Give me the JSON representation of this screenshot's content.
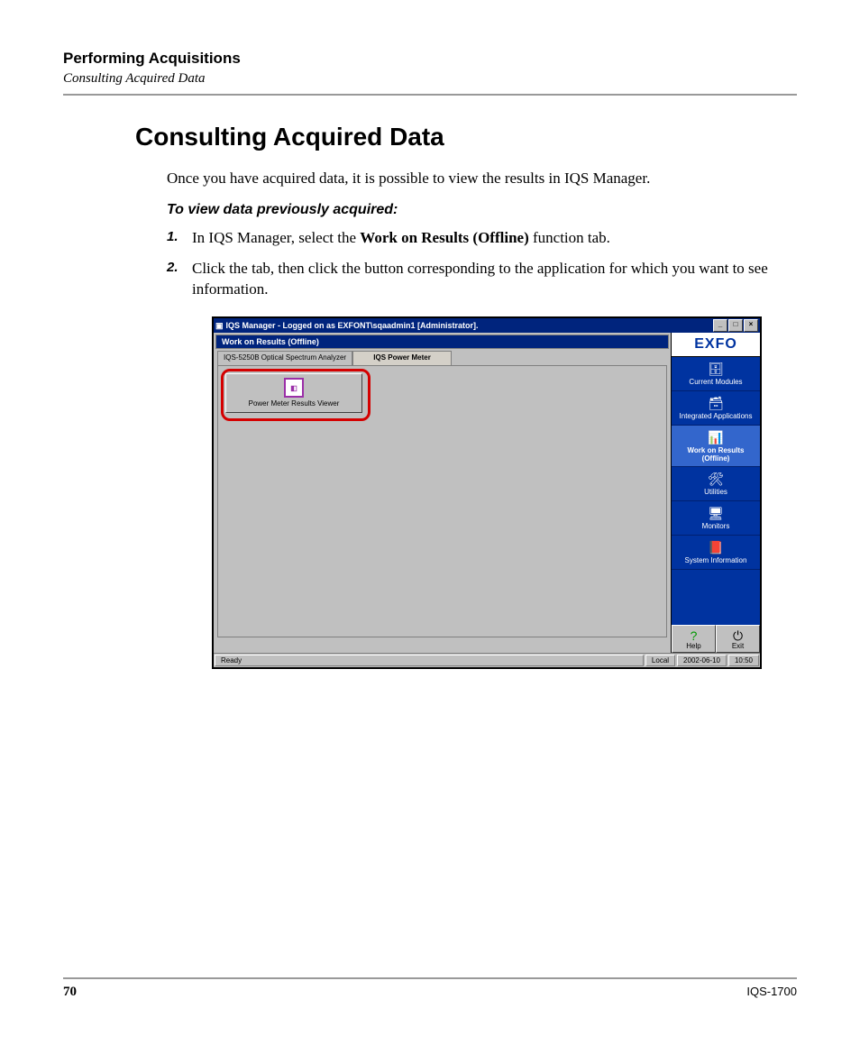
{
  "header": {
    "chapter": "Performing Acquisitions",
    "section_sub": "Consulting Acquired Data"
  },
  "section": {
    "title": "Consulting Acquired Data",
    "intro": "Once you have acquired data, it is possible to view the results in IQS Manager.",
    "procedure_title": "To view data previously acquired:",
    "steps": [
      {
        "num": "1.",
        "pre": "In IQS Manager, select the ",
        "bold": "Work on Results (Offline)",
        "post": " function tab."
      },
      {
        "num": "2.",
        "pre": "Click the tab, then click the button corresponding to the application for which you want to see information.",
        "bold": "",
        "post": ""
      }
    ]
  },
  "screenshot": {
    "title": "IQS Manager - Logged on as EXFONT\\sqaadmin1 [Administrator].",
    "panel_title": "Work on Results (Offline)",
    "tabs": [
      "IQS-5250B Optical Spectrum Analyzer",
      "IQS Power Meter"
    ],
    "result_button": "Power Meter Results Viewer",
    "logo": "EXFO",
    "nav": [
      "Current Modules",
      "Integrated Applications",
      "Work on Results (Offline)",
      "Utilities",
      "Monitors",
      "System Information"
    ],
    "help": "Help",
    "exit": "Exit",
    "status": {
      "ready": "Ready",
      "local": "Local",
      "date": "2002-06-10",
      "time": "10:50"
    }
  },
  "footer": {
    "page": "70",
    "model": "IQS-1700"
  }
}
